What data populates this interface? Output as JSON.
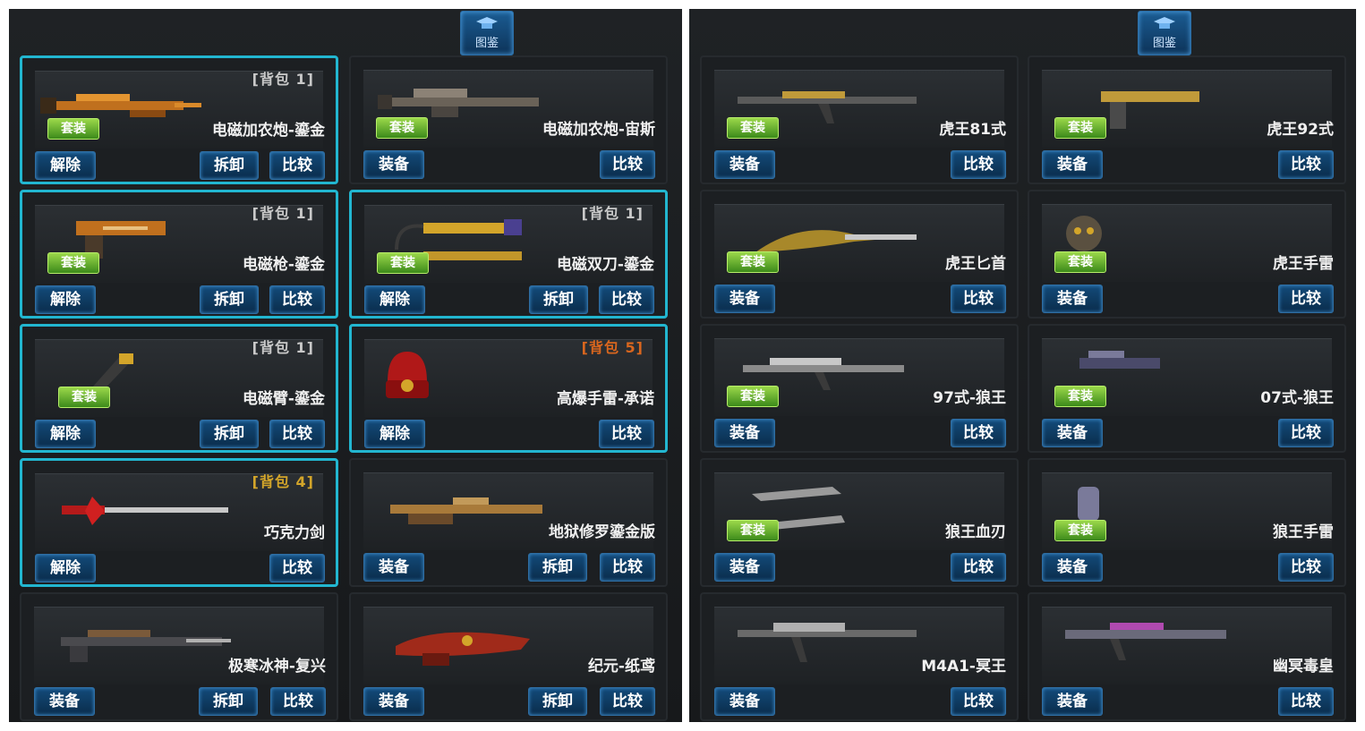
{
  "header": {
    "atlas_label": "图鉴"
  },
  "left_panel": {
    "cards": [
      {
        "pack": "[背包 1]",
        "tag": "套装",
        "name": "电磁加农炮-鎏金",
        "buttons": [
          "解除",
          "拆卸",
          "比较"
        ]
      },
      {
        "pack": "",
        "tag": "套装",
        "name": "电磁加农炮-宙斯",
        "buttons": [
          "装备",
          "",
          "比较"
        ]
      },
      {
        "pack": "[背包 1]",
        "tag": "套装",
        "name": "电磁枪-鎏金",
        "buttons": [
          "解除",
          "拆卸",
          "比较"
        ]
      },
      {
        "pack": "[背包 1]",
        "tag": "套装",
        "name": "电磁双刀-鎏金",
        "buttons": [
          "解除",
          "拆卸",
          "比较"
        ]
      },
      {
        "pack": "[背包 1]",
        "tag": "套装",
        "name": "电磁臂-鎏金",
        "buttons": [
          "解除",
          "拆卸",
          "比较"
        ]
      },
      {
        "pack": "[背包 5]",
        "tag": "",
        "name": "高爆手雷-承诺",
        "buttons": [
          "解除",
          "",
          "比较"
        ]
      },
      {
        "pack": "[背包 4]",
        "tag": "",
        "name": "巧克力剑",
        "buttons": [
          "解除",
          "",
          "比较"
        ]
      },
      {
        "pack": "",
        "tag": "",
        "name": "地狱修罗鎏金版",
        "buttons": [
          "装备",
          "拆卸",
          "比较"
        ]
      },
      {
        "pack": "",
        "tag": "",
        "name": "极寒冰神-复兴",
        "buttons": [
          "装备",
          "拆卸",
          "比较"
        ]
      },
      {
        "pack": "",
        "tag": "",
        "name": "纪元-纸鸢",
        "buttons": [
          "装备",
          "拆卸",
          "比较"
        ]
      }
    ]
  },
  "right_panel": {
    "cards": [
      {
        "tag": "套装",
        "name": "虎王81式",
        "buttons": [
          "装备",
          "比较"
        ]
      },
      {
        "tag": "套装",
        "name": "虎王92式",
        "buttons": [
          "装备",
          "比较"
        ]
      },
      {
        "tag": "套装",
        "name": "虎王匕首",
        "buttons": [
          "装备",
          "比较"
        ]
      },
      {
        "tag": "套装",
        "name": "虎王手雷",
        "buttons": [
          "装备",
          "比较"
        ]
      },
      {
        "tag": "套装",
        "name": "97式-狼王",
        "buttons": [
          "装备",
          "比较"
        ]
      },
      {
        "tag": "套装",
        "name": "07式-狼王",
        "buttons": [
          "装备",
          "比较"
        ]
      },
      {
        "tag": "套装",
        "name": "狼王血刃",
        "buttons": [
          "装备",
          "比较"
        ]
      },
      {
        "tag": "套装",
        "name": "狼王手雷",
        "buttons": [
          "装备",
          "比较"
        ]
      },
      {
        "tag": "",
        "name": "M4A1-冥王",
        "buttons": [
          "装备",
          "比较"
        ]
      },
      {
        "tag": "",
        "name": "幽冥毒皇",
        "buttons": [
          "装备",
          "比较"
        ]
      }
    ]
  },
  "icons": [
    "graduation-cap-icon",
    "weapon-image",
    "grenade-ring-box-icon"
  ],
  "colors": {
    "selected_border": "#22b6d0",
    "tag_green": "#6abf2e",
    "button_blue": "#134b7a",
    "pack_orange": "#d9661e",
    "pack_yellow": "#d3a52a"
  }
}
